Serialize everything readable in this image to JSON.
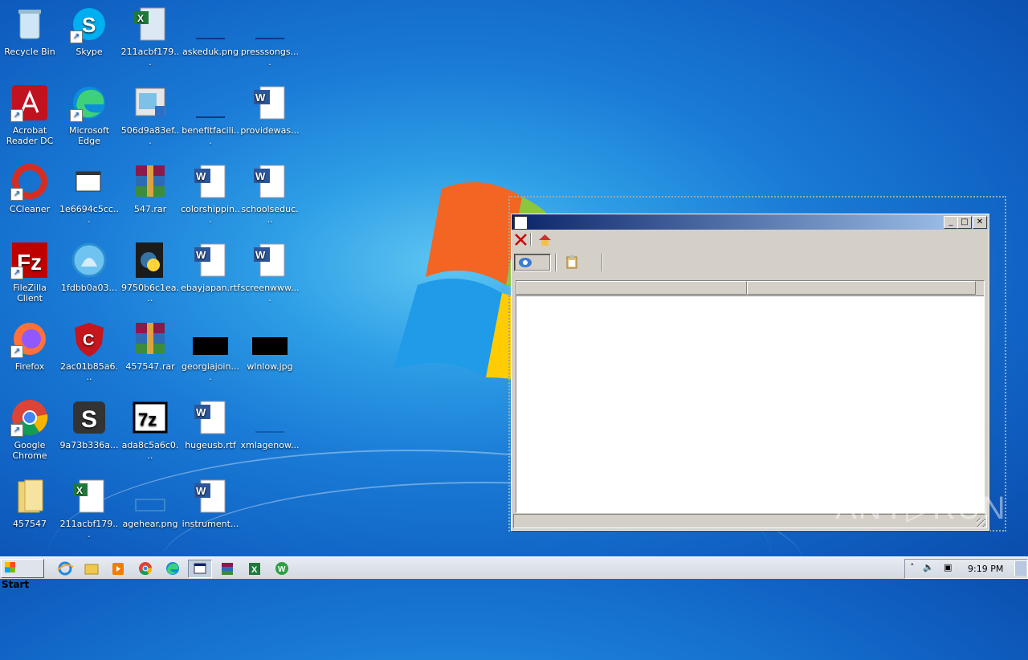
{
  "desktop": {
    "icons": [
      {
        "label": "Recycle Bin"
      },
      {
        "label": "Skype"
      },
      {
        "label": "211acbf179..."
      },
      {
        "label": "askeduk.png"
      },
      {
        "label": "presssongs...."
      },
      {
        "label": "Acrobat Reader DC"
      },
      {
        "label": "Microsoft Edge"
      },
      {
        "label": "506d9a83ef..."
      },
      {
        "label": "benefitfacili..."
      },
      {
        "label": "providewas..."
      },
      {
        "label": "CCleaner"
      },
      {
        "label": "1e6694c5cc..."
      },
      {
        "label": "547.rar"
      },
      {
        "label": "colorshippin..."
      },
      {
        "label": "schoolseduc..."
      },
      {
        "label": "FileZilla Client"
      },
      {
        "label": "1fdbb0a03..."
      },
      {
        "label": "9750b6c1ea..."
      },
      {
        "label": "ebayjapan.rtf"
      },
      {
        "label": "screenwww...."
      },
      {
        "label": "Firefox"
      },
      {
        "label": "2ac01b85a6..."
      },
      {
        "label": "457547.rar"
      },
      {
        "label": "georgiajoin...."
      },
      {
        "label": "wlnlow.jpg"
      },
      {
        "label": "Google Chrome"
      },
      {
        "label": "9a73b336a..."
      },
      {
        "label": "ada8c5a6c0..."
      },
      {
        "label": "hugeusb.rtf"
      },
      {
        "label": "xmlagenow..."
      },
      {
        "label": "457547"
      },
      {
        "label": "211acbf179..."
      },
      {
        "label": "agehear.png"
      },
      {
        "label": "instrument..."
      }
    ]
  },
  "window": {
    "minimize": "_",
    "maximize": "□",
    "close": "✕"
  },
  "taskbar": {
    "start_label": "Start",
    "clock": "9:19 PM"
  },
  "watermark": "ANY▷RUN"
}
